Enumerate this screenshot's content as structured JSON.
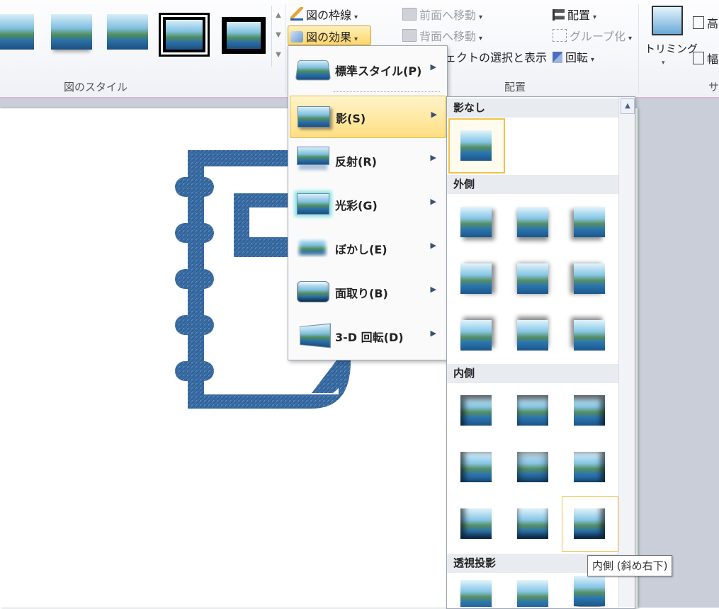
{
  "ribbon": {
    "styles_group_label": "図のスタイル",
    "arrange_group_label": "配置",
    "size_group_label_partial": "サ",
    "picture_border_label": "図の枠線",
    "picture_effects_label": "図の効果",
    "bring_forward_label": "前面へ移動",
    "send_backward_label": "背面へ移動",
    "selection_pane_label": "ジェクトの選択と表示",
    "align_label": "配置",
    "group_label": "グループ化",
    "rotate_label": "回転",
    "crop_label": "トリミング",
    "height_label_partial": "高",
    "width_label_partial": "幅"
  },
  "effects_menu": {
    "items": [
      {
        "label": "標準スタイル(P)"
      },
      {
        "label": "影(S)"
      },
      {
        "label": "反射(R)"
      },
      {
        "label": "光彩(G)"
      },
      {
        "label": "ぼかし(E)"
      },
      {
        "label": "面取り(B)"
      },
      {
        "label": "3-D 回転(D)"
      }
    ],
    "active_index": 1
  },
  "shadow_submenu": {
    "sections": [
      {
        "title": "影なし"
      },
      {
        "title": "外側"
      },
      {
        "title": "内側"
      },
      {
        "title": "透視投影"
      }
    ]
  },
  "tooltip": "内側 (斜め右下)",
  "colors": {
    "accent_highlight": "#ffd66b",
    "notebook_blue": "#3c6ea6"
  }
}
